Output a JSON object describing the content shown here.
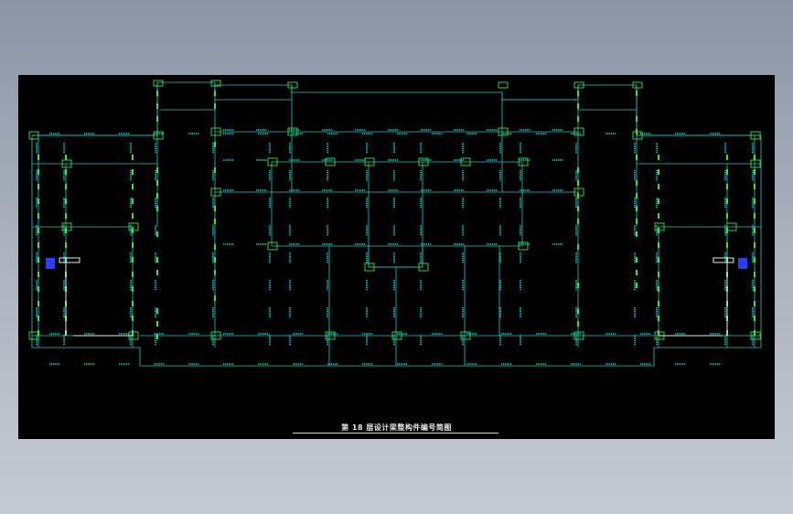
{
  "drawing": {
    "title": "第 18 层设计梁整构件编号简图"
  },
  "colors": {
    "background": "#000000",
    "beam": "#29c7c7",
    "column": "#39e639",
    "wall": "#e8e8e8",
    "accent": "#2f3cff"
  }
}
